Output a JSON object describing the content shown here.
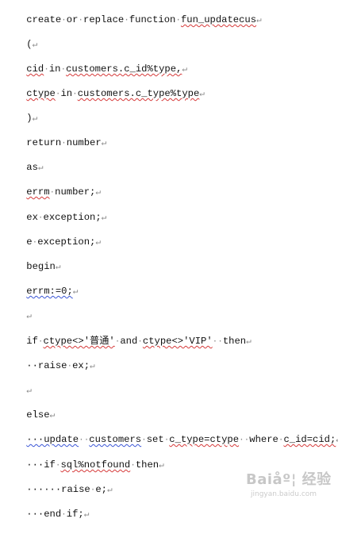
{
  "document": {
    "lines": [
      {
        "pre": "create",
        "s1": "·",
        "a": "or",
        "s2": "·",
        "b": "replace",
        "s3": "·",
        "c": "function",
        "s4": "·",
        "d": "fun_updatecus",
        "mark": "↵"
      },
      {
        "pre": "(",
        "mark": "↵"
      },
      {
        "pre": "cid",
        "s1": "·",
        "a": "in",
        "s2": "·",
        "b": "customers.c_id%type,",
        "mark": "↵"
      },
      {
        "pre": "ctype",
        "s1": "·",
        "a": "in",
        "s2": "·",
        "b": "customers.c_type%type",
        "mark": "↵"
      },
      {
        "pre": ")",
        "mark": "↵"
      },
      {
        "pre": "return",
        "s1": "·",
        "a": "number",
        "mark": "↵"
      },
      {
        "pre": "as",
        "mark": "↵"
      },
      {
        "pre": "errm",
        "s1": "·",
        "a": "number;",
        "mark": "↵"
      },
      {
        "pre": "ex",
        "s1": "·",
        "a": "exception;",
        "mark": "↵"
      },
      {
        "pre": "e",
        "s1": "·",
        "a": "exception;",
        "mark": "↵"
      },
      {
        "pre": "begin",
        "mark": "↵"
      },
      {
        "pre": "errm:=0;",
        "mark": "↵"
      },
      {
        "pre": "",
        "mark": "↵"
      },
      {
        "pre": "if",
        "s1": "·",
        "a": "ctype<>'普通'",
        "s2": "·",
        "b": "and",
        "s3": "·",
        "c": "ctype<>'VIP'",
        "s4": "··",
        "d": "then",
        "mark": "↵"
      },
      {
        "pre": "··raise",
        "s1": "·",
        "a": "ex;",
        "mark": "↵"
      },
      {
        "pre": "",
        "mark": "↵"
      },
      {
        "pre": "else",
        "mark": "↵"
      },
      {
        "pre": "···update",
        "s1": "··",
        "a": "customers",
        "s2": "·",
        "b": "set",
        "s3": "·",
        "c": "c_type=ctype",
        "s4": "··",
        "d": "where",
        "s5": "·",
        "e": "c_id=cid;",
        "mark": "↵"
      },
      {
        "pre": "···if",
        "s1": "·",
        "a": "sql%notfound",
        "s2": "·",
        "b": "then",
        "mark": "↵"
      },
      {
        "pre": "······raise",
        "s1": "·",
        "a": "e;",
        "mark": "↵"
      },
      {
        "pre": "···end",
        "s1": "·",
        "a": "if;",
        "mark": "↵"
      }
    ]
  },
  "watermark": {
    "logo_text": "Baiåº¦ 经验",
    "domain": "jingyan.baidu.com"
  }
}
